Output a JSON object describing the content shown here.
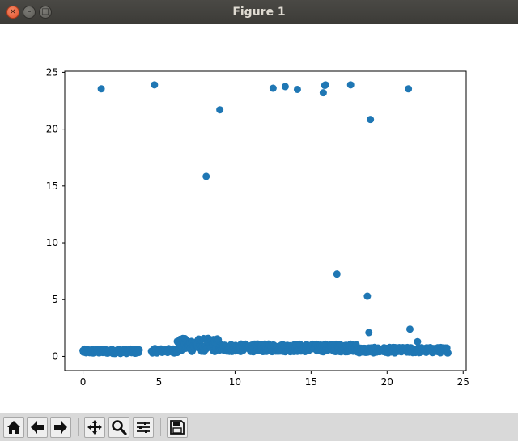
{
  "window": {
    "title": "Figure 1"
  },
  "titlebar_buttons": {
    "close": "×",
    "minimize": "–",
    "maximize": "□"
  },
  "toolbar": {
    "buttons": [
      {
        "name": "home-icon",
        "tooltip": "Home"
      },
      {
        "name": "back-arrow-icon",
        "tooltip": "Back"
      },
      {
        "name": "forward-arrow-icon",
        "tooltip": "Forward"
      },
      {
        "name": "pan-icon",
        "tooltip": "Pan"
      },
      {
        "name": "zoom-icon",
        "tooltip": "Zoom"
      },
      {
        "name": "configure-subplots-icon",
        "tooltip": "Subplots"
      },
      {
        "name": "save-icon",
        "tooltip": "Save"
      }
    ]
  },
  "chart_data": {
    "type": "scatter",
    "title": "",
    "xlabel": "",
    "ylabel": "",
    "xlim": [
      -1.2,
      25.2
    ],
    "ylim": [
      -1.25,
      25.1
    ],
    "xticks": [
      0,
      5,
      10,
      15,
      20,
      25
    ],
    "yticks": [
      0,
      5,
      10,
      15,
      20,
      25
    ],
    "marker_color": "#1f77b4",
    "outliers": [
      [
        1.2,
        23.55
      ],
      [
        4.7,
        23.9
      ],
      [
        8.1,
        15.85
      ],
      [
        9.0,
        21.7
      ],
      [
        12.5,
        23.6
      ],
      [
        13.3,
        23.75
      ],
      [
        14.1,
        23.5
      ],
      [
        15.8,
        23.2
      ],
      [
        15.9,
        23.85
      ],
      [
        15.95,
        23.9
      ],
      [
        17.6,
        23.9
      ],
      [
        18.9,
        20.85
      ],
      [
        21.4,
        23.55
      ],
      [
        16.7,
        7.25
      ],
      [
        18.7,
        5.3
      ],
      [
        18.8,
        2.1
      ],
      [
        21.5,
        2.4
      ],
      [
        22.0,
        1.3
      ]
    ],
    "baseline_segments": [
      {
        "x": [
          0.0,
          3.7
        ],
        "y_center": 0.45,
        "spread": 0.2
      },
      {
        "x": [
          4.5,
          6.2
        ],
        "y_center": 0.5,
        "spread": 0.2
      },
      {
        "x": [
          6.2,
          9.0
        ],
        "y_center": 1.0,
        "spread": 0.6
      },
      {
        "x": [
          9.0,
          18.0
        ],
        "y_center": 0.75,
        "spread": 0.35
      },
      {
        "x": [
          18.0,
          24.0
        ],
        "y_center": 0.55,
        "spread": 0.25
      }
    ]
  }
}
